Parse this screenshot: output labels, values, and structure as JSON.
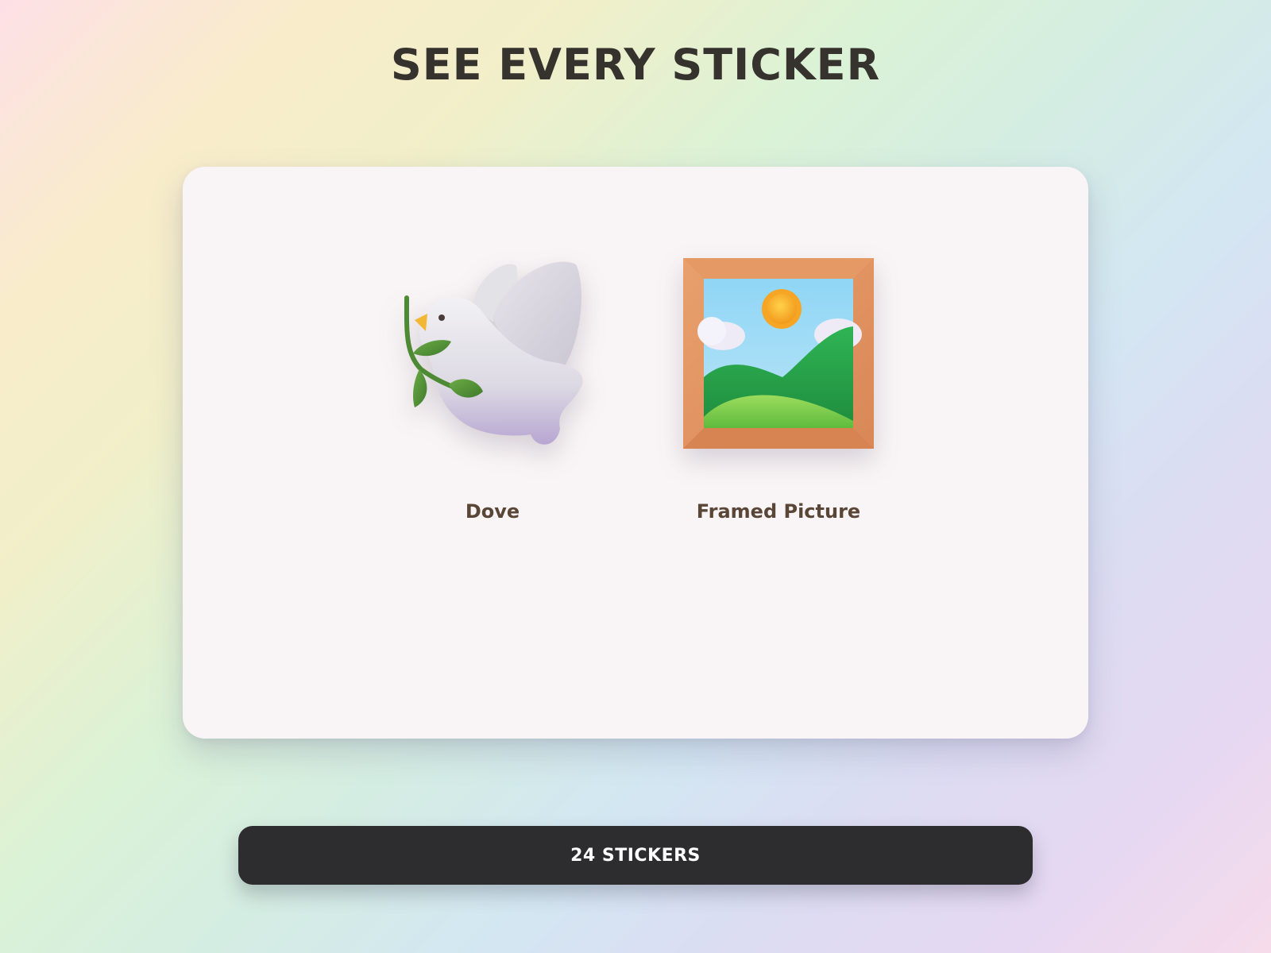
{
  "page": {
    "title": "SEE EVERY STICKER"
  },
  "stickers": [
    {
      "label": "Dove",
      "icon": "dove-icon"
    },
    {
      "label": "Framed Picture",
      "icon": "framed-picture-icon"
    }
  ],
  "footer": {
    "count_label": "24 STICKERS"
  },
  "colors": {
    "title_text": "#36322d",
    "panel_background": "#f9f4f5",
    "sticker_label": "#5a4636",
    "button_background": "#2d2c2f",
    "button_text": "#ffffff"
  }
}
